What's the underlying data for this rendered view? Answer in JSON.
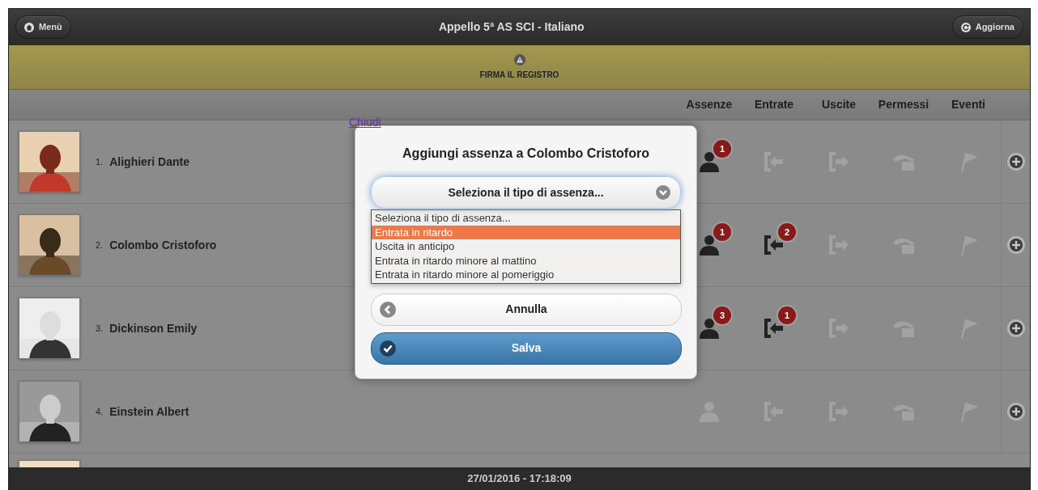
{
  "header": {
    "menu_button": "Menù",
    "title": "Appello 5ª AS SCI - Italiano",
    "refresh_button": "Aggiorna"
  },
  "banner": {
    "text": "FIRMA IL REGISTRO"
  },
  "columns": [
    "Assenze",
    "Entrate",
    "Uscite",
    "Permessi",
    "Eventi"
  ],
  "students": [
    {
      "kind": "student",
      "number": "1.",
      "name": "Alighieri Dante",
      "marks": [
        {
          "kind": "absence",
          "active": true,
          "count": "1"
        },
        {
          "kind": "entry",
          "active": false
        },
        {
          "kind": "exit",
          "active": false
        },
        {
          "kind": "permit",
          "active": false
        },
        {
          "kind": "event",
          "active": false
        }
      ]
    },
    {
      "kind": "student",
      "number": "2.",
      "name": "Colombo Cristoforo",
      "marks": [
        {
          "kind": "absence",
          "active": true,
          "count": "1"
        },
        {
          "kind": "entry",
          "active": true,
          "count": "2"
        },
        {
          "kind": "exit",
          "active": false
        },
        {
          "kind": "permit",
          "active": false
        },
        {
          "kind": "event",
          "active": false
        }
      ]
    },
    {
      "kind": "student",
      "number": "3.",
      "name": "Dickinson Emily",
      "marks": [
        {
          "kind": "absence",
          "active": true,
          "count": "3"
        },
        {
          "kind": "entry",
          "active": true,
          "count": "1"
        },
        {
          "kind": "exit",
          "active": false
        },
        {
          "kind": "permit",
          "active": false
        },
        {
          "kind": "event",
          "active": false
        }
      ]
    },
    {
      "kind": "student",
      "number": "4.",
      "name": "Einstein Albert",
      "marks": [
        {
          "kind": "absence",
          "active": false
        },
        {
          "kind": "entry",
          "active": false
        },
        {
          "kind": "exit",
          "active": false
        },
        {
          "kind": "permit",
          "active": false
        },
        {
          "kind": "event",
          "active": false
        }
      ]
    },
    {
      "kind": "picture"
    }
  ],
  "dialog": {
    "close_link": "Chiudi",
    "title": "Aggiungi assenza a Colombo Cristoforo",
    "select": {
      "value": "Seleziona il tipo di assenza...",
      "options": [
        {
          "label": "Seleziona il tipo di assenza...",
          "highlighted": false
        },
        {
          "label": "Entrata in ritardo",
          "highlighted": true
        },
        {
          "label": "Uscita in anticipo",
          "highlighted": false
        },
        {
          "label": "Entrata in ritardo minore al mattino",
          "highlighted": false
        },
        {
          "label": "Entrata in ritardo minore al pomeriggio",
          "highlighted": false
        }
      ]
    },
    "buttons": [
      {
        "kind": "cancel",
        "label": "Annulla"
      },
      {
        "kind": "save",
        "label": "Salva"
      }
    ]
  },
  "footer": "27/01/2016 - 17:18:09"
}
